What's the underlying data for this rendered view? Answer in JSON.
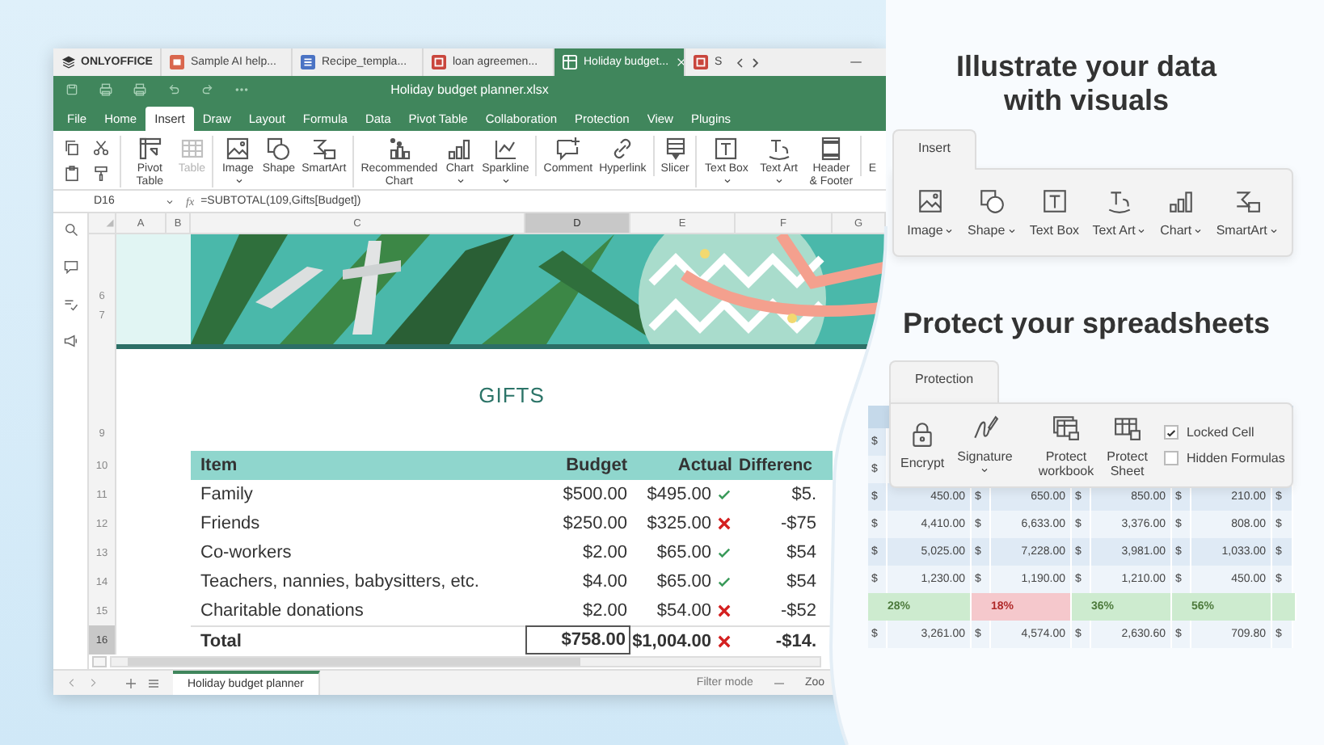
{
  "tab_bar": {
    "logo": "ONLYOFFICE",
    "tabs": [
      {
        "label": "Sample AI help...",
        "kind": "slides",
        "selected": false
      },
      {
        "label": "Recipe_templa...",
        "kind": "doc",
        "selected": false
      },
      {
        "label": "loan agreemen...",
        "kind": "pdf",
        "selected": false
      },
      {
        "label": "Holiday budget...",
        "kind": "sheet",
        "selected": true
      },
      {
        "label": "S",
        "kind": "pdf",
        "selected": false
      }
    ]
  },
  "window": {
    "title": "Holiday budget planner.xlsx"
  },
  "menu": [
    {
      "label": "File",
      "selected": false
    },
    {
      "label": "Home",
      "selected": false
    },
    {
      "label": "Insert",
      "selected": true
    },
    {
      "label": "Draw",
      "selected": false
    },
    {
      "label": "Layout",
      "selected": false
    },
    {
      "label": "Formula",
      "selected": false
    },
    {
      "label": "Data",
      "selected": false
    },
    {
      "label": "Pivot Table",
      "selected": false
    },
    {
      "label": "Collaboration",
      "selected": false
    },
    {
      "label": "Protection",
      "selected": false
    },
    {
      "label": "View",
      "selected": false
    },
    {
      "label": "Plugins",
      "selected": false
    }
  ],
  "toolbar_groups": [
    {
      "items": [
        {
          "label": "Pivot Table",
          "dropdown": false,
          "disabled": false
        },
        {
          "label": "Table",
          "dropdown": false,
          "disabled": true
        }
      ]
    },
    {
      "items": [
        {
          "label": "Image",
          "dropdown": true,
          "disabled": false
        },
        {
          "label": "Shape",
          "dropdown": false,
          "disabled": false
        },
        {
          "label": "SmartArt",
          "dropdown": false,
          "disabled": false
        }
      ]
    },
    {
      "items": [
        {
          "label": "Recommended Chart",
          "dropdown": false,
          "disabled": false
        },
        {
          "label": "Chart",
          "dropdown": true,
          "disabled": false
        },
        {
          "label": "Sparkline",
          "dropdown": true,
          "disabled": false
        }
      ]
    },
    {
      "items": [
        {
          "label": "Comment",
          "dropdown": false,
          "disabled": false
        },
        {
          "label": "Hyperlink",
          "dropdown": false,
          "disabled": false
        }
      ]
    },
    {
      "items": [
        {
          "label": "Slicer",
          "dropdown": false,
          "disabled": false
        }
      ]
    },
    {
      "items": [
        {
          "label": "Text Box",
          "dropdown": true,
          "disabled": false
        },
        {
          "label": "Text Art",
          "dropdown": true,
          "disabled": false
        },
        {
          "label": "Header & Footer",
          "dropdown": false,
          "disabled": false
        }
      ]
    },
    {
      "items": [
        {
          "label": "E",
          "dropdown": false,
          "disabled": false
        }
      ]
    }
  ],
  "formula_bar": {
    "cell": "D16",
    "function_label": "fx",
    "formula": "=SUBTOTAL(109,Gifts[Budget])"
  },
  "columns": [
    {
      "label": "A",
      "selected": false
    },
    {
      "label": "B",
      "selected": false
    },
    {
      "label": "C",
      "selected": false
    },
    {
      "label": "D",
      "selected": true
    },
    {
      "label": "E",
      "selected": false
    },
    {
      "label": "F",
      "selected": false
    },
    {
      "label": "G",
      "selected": false
    }
  ],
  "banner_rows": [
    "6",
    "7"
  ],
  "title_row": {
    "number": "9",
    "text": "GIFTS"
  },
  "table": {
    "header": {
      "number": "10",
      "cells": [
        "Item",
        "Budget",
        "Actual",
        "Differenc"
      ]
    },
    "rows": [
      {
        "number": "11",
        "kind": "item",
        "item": "Family",
        "budget": "$500.00",
        "actual": "$495.00",
        "ok": true,
        "difference": "$5.",
        "selected": false
      },
      {
        "number": "12",
        "kind": "item",
        "item": "Friends",
        "budget": "$250.00",
        "actual": "$325.00",
        "ok": false,
        "difference": "-$75",
        "selected": false
      },
      {
        "number": "13",
        "kind": "item",
        "item": "Co-workers",
        "budget": "$2.00",
        "actual": "$65.00",
        "ok": true,
        "difference": "$54",
        "selected": false
      },
      {
        "number": "14",
        "kind": "item",
        "item": "Teachers, nannies, babysitters, etc.",
        "budget": "$4.00",
        "actual": "$65.00",
        "ok": true,
        "difference": "$54",
        "selected": false
      },
      {
        "number": "15",
        "kind": "item",
        "item": "Charitable donations",
        "budget": "$2.00",
        "actual": "$54.00",
        "ok": false,
        "difference": "-$52",
        "selected": false
      },
      {
        "number": "16",
        "kind": "total",
        "item": "Total",
        "budget": "$758.00",
        "actual": "$1,004.00",
        "ok": false,
        "difference": "-$14.",
        "selected": true
      }
    ]
  },
  "sheet_bar": {
    "sheets": [
      {
        "label": "Holiday budget planner",
        "selected": true
      }
    ],
    "filter": "Filter mode",
    "zoom": "Zoo"
  },
  "promo": {
    "insert_heading": "Illustrate your data with visuals",
    "insert_panel": {
      "tab": "Insert",
      "items": [
        {
          "label": "Image",
          "dropdown": true
        },
        {
          "label": "Shape",
          "dropdown": true
        },
        {
          "label": "Text Box",
          "dropdown": false
        },
        {
          "label": "Text Art",
          "dropdown": true
        },
        {
          "label": "Chart",
          "dropdown": true
        },
        {
          "label": "SmartArt",
          "dropdown": true
        }
      ]
    },
    "protect_heading": "Protect your spreadsheets",
    "protection_panel": {
      "tab": "Protection",
      "items": [
        {
          "label": "Encrypt",
          "dropdown": false
        },
        {
          "label": "Signature",
          "dropdown": true
        },
        {
          "label": "Protect workbook",
          "dropdown": false
        },
        {
          "label": "Protect Sheet",
          "dropdown": false
        }
      ],
      "checks": [
        {
          "label": "Locked Cell",
          "checked": true
        },
        {
          "label": "Hidden Formulas",
          "checked": false
        }
      ]
    },
    "background_table": {
      "rows": [
        {
          "kind": "header"
        },
        {
          "kind": "money",
          "cells": [
            "$"
          ]
        },
        {
          "kind": "money",
          "cells": [
            "$"
          ]
        },
        {
          "kind": "money",
          "cells": [
            "$",
            "450.00",
            "$",
            "650.00",
            "$",
            "850.00",
            "$",
            "210.00",
            "$"
          ]
        },
        {
          "kind": "money",
          "cells": [
            "$",
            "4,410.00",
            "$",
            "6,633.00",
            "$",
            "3,376.00",
            "$",
            "808.00",
            "$"
          ]
        },
        {
          "kind": "money",
          "cells": [
            "$",
            "5,025.00",
            "$",
            "7,228.00",
            "$",
            "3,981.00",
            "$",
            "1,033.00",
            "$"
          ]
        },
        {
          "kind": "money",
          "cells": [
            "$",
            "1,230.00",
            "$",
            "1,190.00",
            "$",
            "1,210.00",
            "$",
            "450.00",
            "$"
          ]
        },
        {
          "kind": "percent",
          "cells": [
            {
              "text": "28%",
              "positive": true
            },
            {
              "text": "18%",
              "positive": false
            },
            {
              "text": "36%",
              "positive": true
            },
            {
              "text": "56%",
              "positive": true
            }
          ]
        },
        {
          "kind": "money",
          "cells": [
            "$",
            "3,261.00",
            "$",
            "4,574.00",
            "$",
            "2,630.60",
            "$",
            "709.80",
            "$"
          ]
        }
      ]
    }
  }
}
